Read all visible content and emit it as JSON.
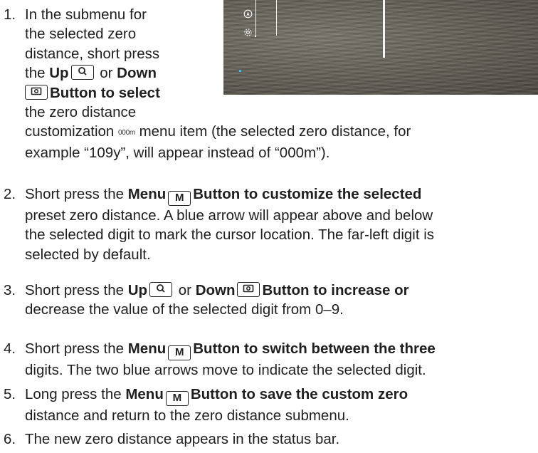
{
  "scope_image": {
    "icons": [
      "compass-icon",
      "gear-icon"
    ]
  },
  "steps": [
    {
      "num": "1.",
      "lines": [
        "In the submenu for",
        "the selected zero",
        "distance, short press",
        "Button to select",
        "the zero distance",
        "customization",
        "menu item (the selected zero distance, for",
        "example “109y”, will appear instead of “000m”)."
      ],
      "the": "the",
      "up": "Up",
      "or": "or",
      "down": "Down",
      "icon_text": "000m"
    },
    {
      "num": "2.",
      "lines": [
        "Short press the",
        "Menu",
        "Button to customize the selected",
        "preset zero distance. A blue arrow will appear above and below",
        "the selected digit to mark the cursor location. The far-left digit is",
        "selected by default."
      ]
    },
    {
      "num": "3.",
      "lines": [
        "Short press the",
        "Up",
        "or",
        "Down",
        "Button to increase or",
        "decrease the value of the selected digit from 0–9."
      ]
    },
    {
      "num": "4.",
      "lines": [
        "Short press the",
        "Menu",
        "Button to switch between the three",
        "digits. The two blue arrows move to indicate the selected digit."
      ]
    },
    {
      "num": "5.",
      "lines": [
        "Long press the",
        "Menu",
        "Button to save the custom zero",
        "distance and return to the zero distance submenu."
      ]
    },
    {
      "num": "6.",
      "lines": [
        "The new zero distance appears in the status bar."
      ]
    }
  ],
  "keys": {
    "menu": "M"
  },
  "colors": {
    "text": "#1f1f1f",
    "cursor_blue": "#3fb7ff"
  }
}
